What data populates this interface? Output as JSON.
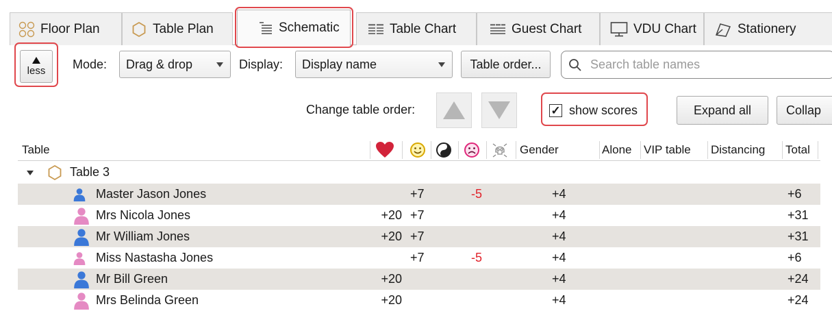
{
  "tabs": [
    {
      "label": "Floor Plan",
      "icon": "floor-plan-icon"
    },
    {
      "label": "Table Plan",
      "icon": "table-plan-icon"
    },
    {
      "label": "Schematic",
      "icon": "schematic-icon",
      "active": true
    },
    {
      "label": "Table Chart",
      "icon": "table-chart-icon"
    },
    {
      "label": "Guest Chart",
      "icon": "guest-chart-icon"
    },
    {
      "label": "VDU Chart",
      "icon": "monitor-icon"
    },
    {
      "label": "Stationery",
      "icon": "stationery-icon"
    }
  ],
  "toolbar": {
    "less_label": "less",
    "mode_label": "Mode:",
    "mode_value": "Drag & drop",
    "display_label": "Display:",
    "display_value": "Display name",
    "table_order_label": "Table order...",
    "search_placeholder": "Search table names",
    "change_order_label": "Change table order:",
    "show_scores_label": "show scores",
    "show_scores_checked": true,
    "expand_all_label": "Expand all",
    "collapse_label": "Collap"
  },
  "table": {
    "columns": {
      "table": "Table",
      "love_icon": "heart-icon",
      "smile_icon": "smiley-icon",
      "yinyang_icon": "yin-yang-icon",
      "sad_icon": "sad-face-icon",
      "skull_icon": "skull-icon",
      "gender": "Gender",
      "alone": "Alone",
      "vip": "VIP table",
      "distancing": "Distancing",
      "total": "Total"
    },
    "group": {
      "name": "Table 3",
      "expanded": true
    },
    "rows": [
      {
        "name": "Master Jason Jones",
        "gender": "male",
        "love": "",
        "smile": "+7",
        "yinyang": "",
        "sad": "-5",
        "skull": "",
        "gender_score": "+4",
        "alone": "",
        "vip": "",
        "distancing": "",
        "total": "+6"
      },
      {
        "name": "Mrs Nicola Jones",
        "gender": "female",
        "love": "+20",
        "smile": "+7",
        "yinyang": "",
        "sad": "",
        "skull": "",
        "gender_score": "+4",
        "alone": "",
        "vip": "",
        "distancing": "",
        "total": "+31"
      },
      {
        "name": "Mr William Jones",
        "gender": "male",
        "love": "+20",
        "smile": "+7",
        "yinyang": "",
        "sad": "",
        "skull": "",
        "gender_score": "+4",
        "alone": "",
        "vip": "",
        "distancing": "",
        "total": "+31"
      },
      {
        "name": "Miss Nastasha Jones",
        "gender": "female",
        "love": "",
        "smile": "+7",
        "yinyang": "",
        "sad": "-5",
        "skull": "",
        "gender_score": "+4",
        "alone": "",
        "vip": "",
        "distancing": "",
        "total": "+6"
      },
      {
        "name": "Mr Bill Green",
        "gender": "male",
        "love": "+20",
        "smile": "",
        "yinyang": "",
        "sad": "",
        "skull": "",
        "gender_score": "+4",
        "alone": "",
        "vip": "",
        "distancing": "",
        "total": "+24"
      },
      {
        "name": "Mrs Belinda Green",
        "gender": "female",
        "love": "+20",
        "smile": "",
        "yinyang": "",
        "sad": "",
        "skull": "",
        "gender_score": "+4",
        "alone": "",
        "vip": "",
        "distancing": "",
        "total": "+24"
      }
    ]
  },
  "colors": {
    "highlight": "#e0474c",
    "male": "#3b78d8",
    "female": "#e58ac3",
    "negative": "#e1232b",
    "heart": "#d2233a",
    "smile": "#d9a800",
    "sad": "#e0267a",
    "row_shade": "#e6e3df"
  }
}
